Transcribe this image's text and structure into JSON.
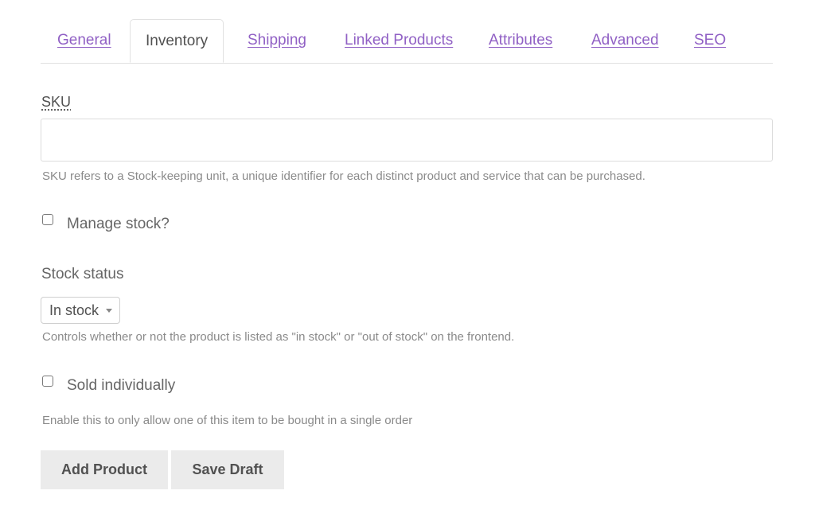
{
  "tabs": [
    {
      "label": "General",
      "active": false
    },
    {
      "label": "Inventory",
      "active": true
    },
    {
      "label": "Shipping",
      "active": false
    },
    {
      "label": "Linked Products",
      "active": false
    },
    {
      "label": "Attributes",
      "active": false
    },
    {
      "label": "Advanced",
      "active": false
    },
    {
      "label": "SEO",
      "active": false
    }
  ],
  "sku": {
    "label": "SKU",
    "value": "",
    "placeholder": "",
    "help": "SKU refers to a Stock-keeping unit, a unique identifier for each distinct product and service that can be purchased."
  },
  "manage_stock": {
    "label": "Manage stock?",
    "checked": false
  },
  "stock_status": {
    "label": "Stock status",
    "selected": "In stock",
    "help": "Controls whether or not the product is listed as \"in stock\" or \"out of stock\" on the frontend."
  },
  "sold_individually": {
    "label": "Sold individually",
    "checked": false,
    "help": "Enable this to only allow one of this item to be bought in a single order"
  },
  "buttons": {
    "add_product": "Add Product",
    "save_draft": "Save Draft"
  },
  "colors": {
    "link": "#9161c5",
    "text": "#515151",
    "help_text": "#8a8a8a",
    "button_bg": "#ebebeb"
  }
}
